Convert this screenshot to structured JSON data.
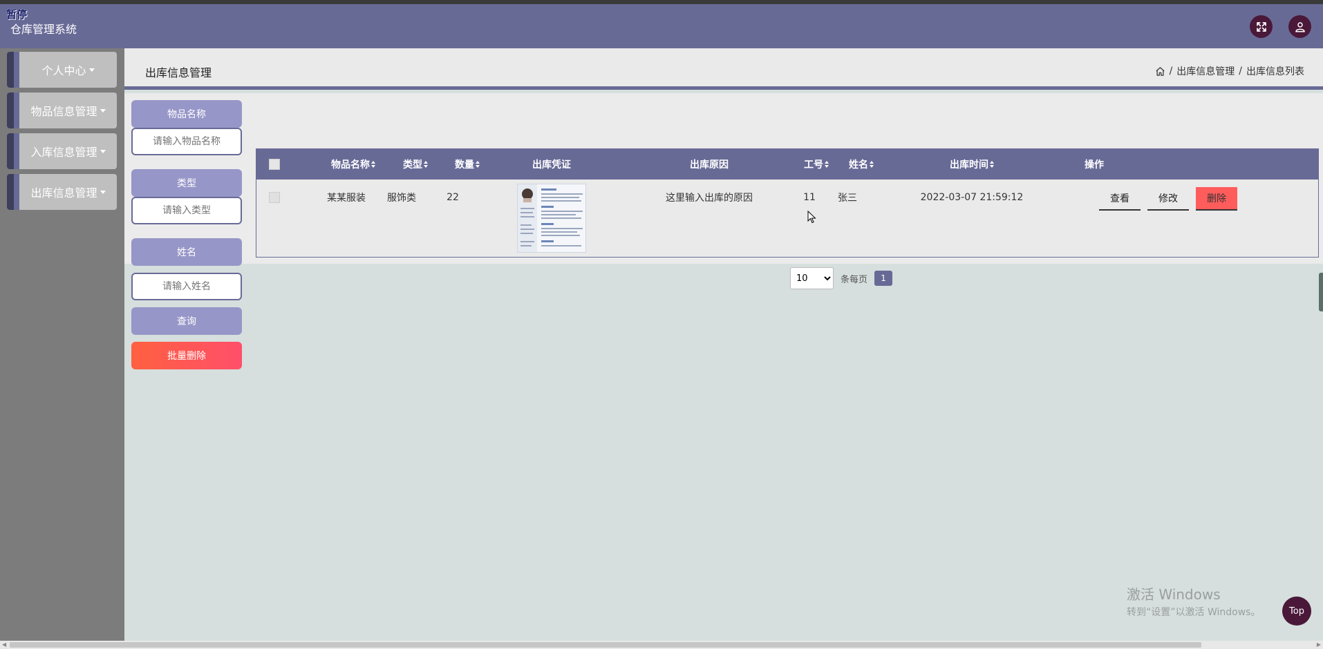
{
  "header": {
    "paused_label": "暂停",
    "app_title": "仓库管理系统"
  },
  "sidebar": {
    "items": [
      {
        "label": "个人中心"
      },
      {
        "label": "物品信息管理"
      },
      {
        "label": "入库信息管理"
      },
      {
        "label": "出库信息管理"
      }
    ]
  },
  "page": {
    "title": "出库信息管理",
    "breadcrumb": [
      "出库信息管理",
      "出库信息列表"
    ],
    "breadcrumb_sep": "/"
  },
  "filters": {
    "item_name_label": "物品名称",
    "item_name_placeholder": "请输入物品名称",
    "type_label": "类型",
    "type_placeholder": "请输入类型",
    "name_label": "姓名",
    "name_placeholder": "请输入姓名",
    "search_label": "查询",
    "batch_delete_label": "批量删除"
  },
  "table": {
    "headers": {
      "item_name": "物品名称",
      "type": "类型",
      "quantity": "数量",
      "voucher": "出库凭证",
      "reason": "出库原因",
      "job_no": "工号",
      "name": "姓名",
      "time": "出库时间",
      "actions": "操作"
    },
    "rows": [
      {
        "item_name": "某某服装",
        "type": "服饰类",
        "quantity": "22",
        "reason": "这里输入出库的原因",
        "job_no": "11",
        "name": "张三",
        "time": "2022-03-07 21:59:12",
        "view_label": "查看",
        "edit_label": "修改",
        "delete_label": "删除"
      }
    ]
  },
  "pagination": {
    "page_size": "10",
    "per_page_label": "条每页",
    "current_page": "1"
  },
  "watermark": {
    "line1": "激活 Windows",
    "line2": "转到“设置”以激活 Windows。"
  },
  "top_button": "Top",
  "colors": {
    "primary": "#686a96",
    "button_light": "#9796c8",
    "danger": "#ff5c5c",
    "dark_accent": "#4a1838"
  }
}
